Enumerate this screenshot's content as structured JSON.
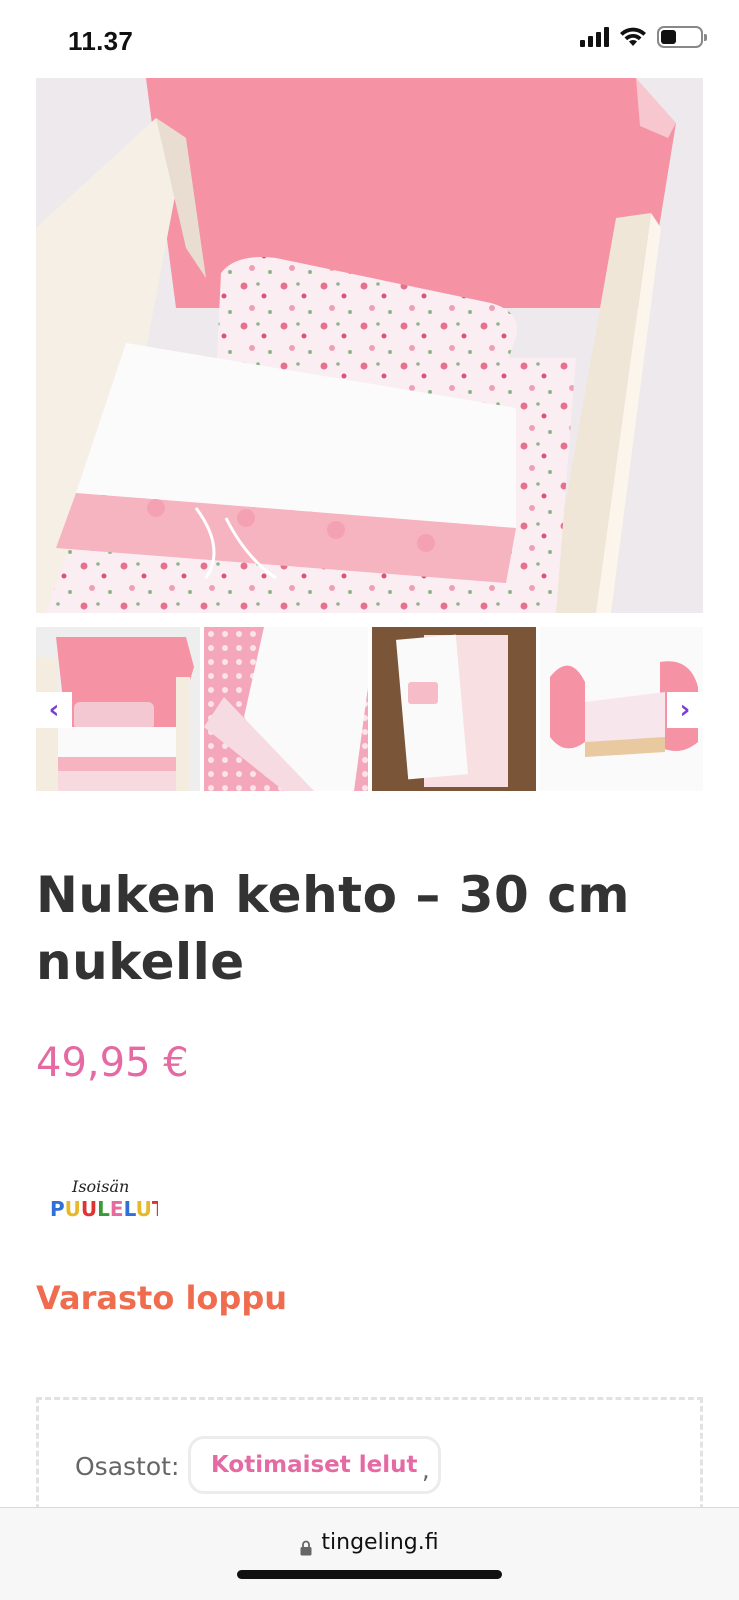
{
  "status": {
    "time": "11.37",
    "battery_level": 0.4
  },
  "icons": {
    "signal": "cellular-signal-icon",
    "wifi": "wifi-icon",
    "battery": "battery-icon",
    "prev": "chevron-left-icon",
    "next": "chevron-right-icon",
    "lock": "lock-icon"
  },
  "gallery": {
    "prev_label": "‹",
    "next_label": "›"
  },
  "product": {
    "title": "Nuken kehto – 30 cm nukelle",
    "price": "49,95 €",
    "brand_logo_text": "Isoisän PUULELUT",
    "stock_status": "Varasto loppu"
  },
  "meta": {
    "categories_label": "Osastot:",
    "categories": [
      "Kotimaiset lelut"
    ],
    "separator": ","
  },
  "browser": {
    "url": "tingeling.fi"
  },
  "colors": {
    "accent_pink": "#e56aa3",
    "out_of_stock": "#f06c4f",
    "arrow_purple": "#7a3fd1",
    "text": "#333333"
  }
}
